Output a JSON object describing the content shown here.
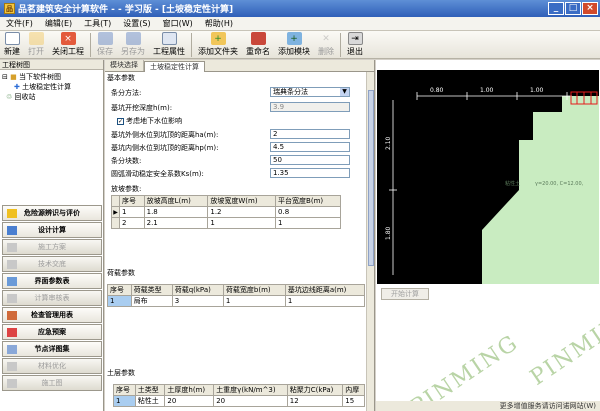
{
  "window": {
    "title": "品茗建筑安全计算软件 - - 学习版 - [土坡稳定性计算]"
  },
  "menu": [
    "文件(F)",
    "编辑(E)",
    "工具(T)",
    "设置(S)",
    "窗口(W)",
    "帮助(H)"
  ],
  "toolbar": {
    "new": "新建",
    "open": "打开",
    "close_project": "关闭工程",
    "save": "保存",
    "save_as": "另存为",
    "project_props": "工程属性",
    "add_folder": "添加文件夹",
    "rename": "重命名",
    "add_module": "添加模块",
    "delete": "删除",
    "exit": "退出"
  },
  "project_tree": {
    "header": "工程树图",
    "items": [
      "当下软件树图",
      "土坡稳定性计算",
      "回收站"
    ]
  },
  "modules": [
    "危险源辨识与评价",
    "设计计算",
    "施工方案",
    "技术交底",
    "界面参数表",
    "计算审核表",
    "检查管理用表",
    "应急预案",
    "节点详图集",
    "材料优化",
    "施工图"
  ],
  "tabs": [
    "模块选择",
    "土坡稳定性计算"
  ],
  "basic_params": {
    "title": "基本参数",
    "method_label": "条分方法:",
    "method_value": "瑞典条分法",
    "depth_label": "基坑开挖深度h(m):",
    "depth_value": "3.9",
    "groundwater_label": "考虑地下水位影响",
    "outer_water_label": "基坑外侧水位到坑顶的距离ha(m):",
    "outer_water_value": "2",
    "inner_water_label": "基坑内侧水位到坑顶的距离hp(m):",
    "inner_water_value": "4.5",
    "slices_label": "条分块数:",
    "slices_value": "50",
    "safety_label": "圆弧滑动稳定安全系数Ks(m):",
    "safety_value": "1.35"
  },
  "slope_params": {
    "title": "放坡参数:",
    "headers": [
      "序号",
      "放坡高度L(m)",
      "放坡宽度W(m)",
      "平台宽度B(m)"
    ],
    "rows": [
      [
        "1",
        "1.8",
        "1.2",
        "0.8"
      ],
      [
        "2",
        "2.1",
        "1",
        "1"
      ]
    ]
  },
  "load_params": {
    "title": "荷载参数",
    "headers": [
      "序号",
      "荷载类型",
      "荷载q(kPa)",
      "荷载宽度b(m)",
      "基坑边线距离a(m)"
    ],
    "rows": [
      [
        "1",
        "局布",
        "3",
        "1",
        "1"
      ]
    ]
  },
  "soil_params": {
    "title": "土层参数",
    "headers": [
      "序号",
      "土类型",
      "土厚度h(m)",
      "土重度γ(kN/m^3)",
      "粘聚力C(kPa)",
      "内摩"
    ],
    "rows": [
      [
        "1",
        "粘性土",
        "20",
        "20",
        "12",
        "15"
      ]
    ]
  },
  "diagram": {
    "dims_top": [
      "0.80",
      "1.00",
      "1.00"
    ],
    "dim_side_top": "2.10",
    "dim_side_bottom": "1.80",
    "soil_label": "粘性土",
    "soil_props": "γ=20.00, C=12.00,"
  },
  "calc_button": "开始计算",
  "watermark": "PINMING",
  "status_text": "更多增值服务请访问诺网站(W)",
  "colors": {
    "title_bar": "#2f5fb8",
    "soil_fill": "#c9ecc1",
    "canvas_bg": "#000000",
    "load_marker": "#e51c1c"
  }
}
